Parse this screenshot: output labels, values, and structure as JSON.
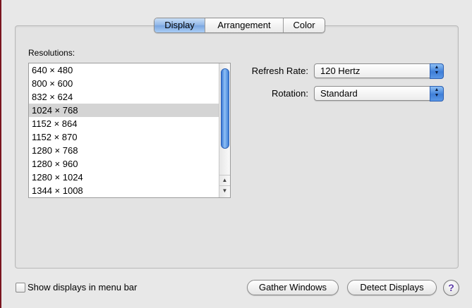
{
  "tabs": [
    {
      "label": "Display",
      "selected": true
    },
    {
      "label": "Arrangement",
      "selected": false
    },
    {
      "label": "Color",
      "selected": false
    }
  ],
  "resolutions": {
    "label": "Resolutions:",
    "items": [
      "640 × 480",
      "800 × 600",
      "832 × 624",
      "1024 × 768",
      "1152 × 864",
      "1152 × 870",
      "1280 × 768",
      "1280 × 960",
      "1280 × 1024",
      "1344 × 1008"
    ],
    "selected": "1024 × 768"
  },
  "refresh_rate": {
    "label": "Refresh Rate:",
    "value": "120 Hertz"
  },
  "rotation": {
    "label": "Rotation:",
    "value": "Standard"
  },
  "footer": {
    "show_displays_label": "Show displays in menu bar",
    "show_displays_checked": false,
    "gather_windows": "Gather Windows",
    "detect_displays": "Detect Displays",
    "help": "?"
  },
  "colors": {
    "accent": "#3f7fd8",
    "selected_row": "#d4d4d4"
  }
}
